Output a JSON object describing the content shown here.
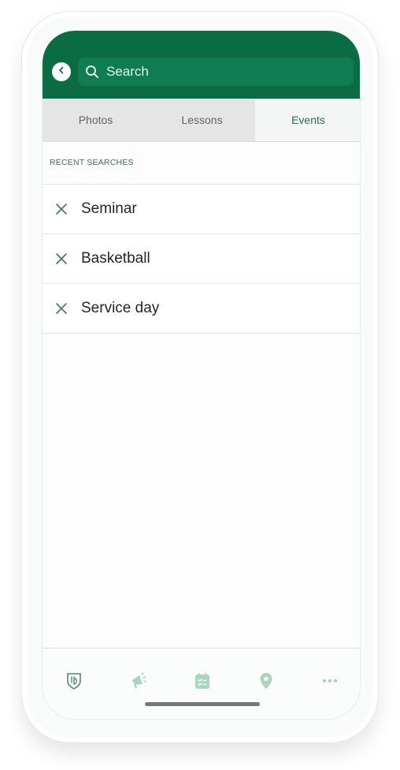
{
  "search": {
    "placeholder": "Search"
  },
  "tabs": [
    {
      "label": "Photos"
    },
    {
      "label": "Lessons"
    },
    {
      "label": "Events"
    }
  ],
  "active_tab": "Events",
  "recent": {
    "title": "RECENT SEARCHES",
    "items": [
      {
        "label": "Seminar"
      },
      {
        "label": "Basketball"
      },
      {
        "label": "Service day"
      }
    ]
  },
  "bottom_nav": {
    "icons": [
      "shield-crest-icon",
      "megaphone-icon",
      "calendar-checklist-icon",
      "map-pin-icon",
      "more-dots-icon"
    ]
  },
  "colors": {
    "header": "#0b6b45",
    "search_bar": "#0f7c53",
    "accent_text": "#2e6b52",
    "nav_icon": "#9fcfb9"
  }
}
